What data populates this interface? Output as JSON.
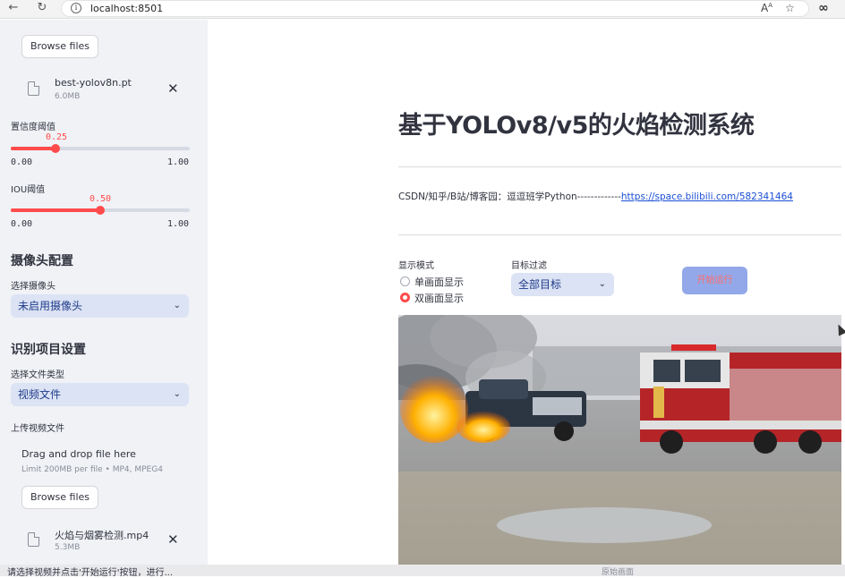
{
  "browser": {
    "url": "localhost:8501",
    "back_icon": "back-arrow-icon",
    "reload_icon": "reload-icon"
  },
  "sidebar": {
    "model_upload": {
      "browse_label": "Browse files",
      "file_name": "best-yolov8n.pt",
      "file_size": "6.0MB"
    },
    "confidence": {
      "label": "置信度阈值",
      "value": "0.25",
      "value_num": 0.25,
      "min": "0.00",
      "max": "1.00"
    },
    "iou": {
      "label": "IOU阈值",
      "value": "0.50",
      "value_num": 0.5,
      "min": "0.00",
      "max": "1.00"
    },
    "camera_section": {
      "title": "摄像头配置",
      "select_label": "选择摄像头",
      "select_value": "未启用摄像头"
    },
    "recognition_section": {
      "title": "识别项目设置",
      "file_type_label": "选择文件类型",
      "file_type_value": "视频文件",
      "upload_label": "上传视频文件",
      "drop_title": "Drag and drop file here",
      "drop_limit": "Limit 200MB per file • MP4, MPEG4",
      "browse_label": "Browse files",
      "file_name": "火焰与烟雾检测.mp4",
      "file_size": "5.3MB"
    }
  },
  "main": {
    "title": "基于YOLOv8/v5的火焰检测系统",
    "credit_text": "CSDN/知乎/B站/博客园：逗逗班学Python-------------",
    "credit_link": "https://space.bilibili.com/582341464",
    "display_mode": {
      "label": "显示模式",
      "options": [
        "单画面显示",
        "双画面显示"
      ],
      "selected": 1
    },
    "target_filter": {
      "label": "目标过滤",
      "value": "全部目标"
    },
    "run_button": "开始运行"
  },
  "bottom": {
    "left_text": "请选择视频并点击'开始运行'按钮，进行...",
    "right_text": "原始画面"
  },
  "colors": {
    "accent": "#ff4b4b",
    "sidebar_bg": "#f0f2f6",
    "select_bg": "#dbe3f4",
    "run_button_bg": "#93a8e8",
    "link": "#1a4fd6"
  }
}
